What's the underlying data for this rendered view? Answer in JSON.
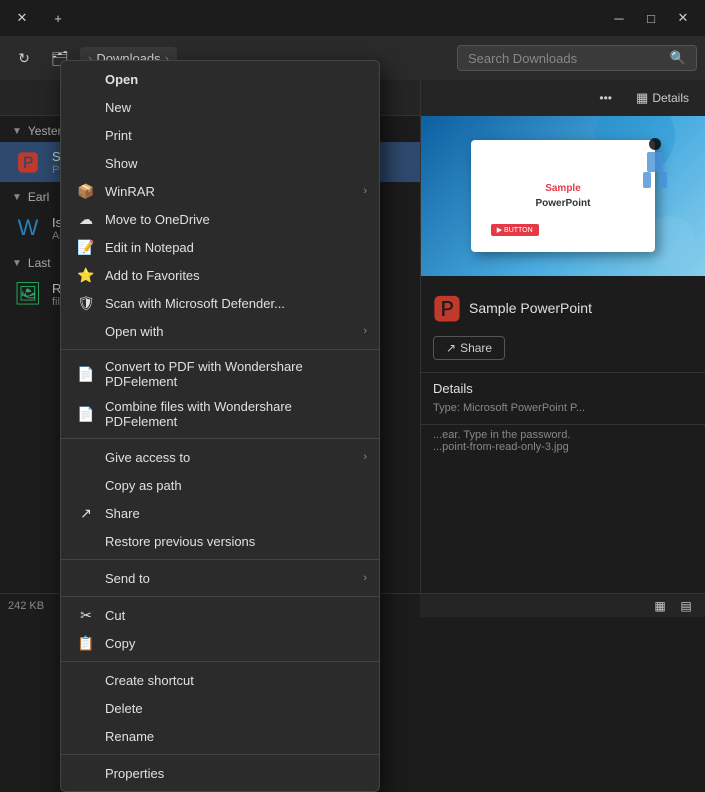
{
  "titlebar": {
    "close": "✕",
    "new_tab": "+",
    "minimize": "─",
    "maximize": "□"
  },
  "navbar": {
    "refresh_label": "↻",
    "breadcrumb": [
      "Downloads",
      "›"
    ],
    "search_placeholder": "Search Downloads",
    "search_icon": "🔍"
  },
  "toolbar": {
    "more_label": "•••",
    "details_label": "Details"
  },
  "sections": {
    "yesterday": "Yesterday",
    "earlier": "Earl",
    "last": "Last"
  },
  "files": [
    {
      "name": "Sa",
      "meta": "PowerPo..."
    },
    {
      "name": "Is Th...",
      "meta": "Ac... Acr..."
    },
    {
      "name": "R",
      "meta": "file-s..."
    }
  ],
  "status": "242 KB",
  "preview": {
    "title": "Sample PowerPoint",
    "accent": "▶ BUTTON"
  },
  "detail": {
    "filename": "Sample PowerPoint",
    "share_label": "Share",
    "details_heading": "Details",
    "type_label": "Type: Microsoft PowerPoint P...",
    "bottom_text": "...ear. Type in the password.",
    "bottom_file": "...point-from-read-only-3.jpg"
  },
  "context_menu": {
    "items": [
      {
        "label": "Open",
        "bold": true,
        "icon": "",
        "arrow": false
      },
      {
        "label": "New",
        "bold": false,
        "icon": "",
        "arrow": false
      },
      {
        "label": "Print",
        "bold": false,
        "icon": "",
        "arrow": false
      },
      {
        "label": "Show",
        "bold": false,
        "icon": "",
        "arrow": false
      },
      {
        "label": "WinRAR",
        "bold": false,
        "icon": "📦",
        "arrow": true
      },
      {
        "label": "Move to OneDrive",
        "bold": false,
        "icon": "☁",
        "arrow": false
      },
      {
        "label": "Edit in Notepad",
        "bold": false,
        "icon": "📝",
        "arrow": false
      },
      {
        "label": "Add to Favorites",
        "bold": false,
        "icon": "⭐",
        "arrow": false
      },
      {
        "label": "Scan with Microsoft Defender...",
        "bold": false,
        "icon": "🛡",
        "arrow": false
      },
      {
        "label": "Open with",
        "bold": false,
        "icon": "",
        "arrow": true
      },
      {
        "separator": true
      },
      {
        "label": "Convert to PDF with Wondershare PDFelement",
        "bold": false,
        "icon": "📄",
        "arrow": false
      },
      {
        "label": "Combine files with Wondershare PDFelement",
        "bold": false,
        "icon": "📄",
        "arrow": false
      },
      {
        "separator": true
      },
      {
        "label": "Give access to",
        "bold": false,
        "icon": "",
        "arrow": true
      },
      {
        "label": "Copy as path",
        "bold": false,
        "icon": "",
        "arrow": false
      },
      {
        "label": "Share",
        "bold": false,
        "icon": "↗",
        "arrow": false
      },
      {
        "label": "Restore previous versions",
        "bold": false,
        "icon": "",
        "arrow": false
      },
      {
        "separator": true
      },
      {
        "label": "Send to",
        "bold": false,
        "icon": "",
        "arrow": true
      },
      {
        "separator": true
      },
      {
        "label": "Cut",
        "bold": false,
        "icon": "✂",
        "arrow": false
      },
      {
        "label": "Copy",
        "bold": false,
        "icon": "📋",
        "arrow": false
      },
      {
        "separator": true
      },
      {
        "label": "Create shortcut",
        "bold": false,
        "icon": "",
        "arrow": false
      },
      {
        "label": "Delete",
        "bold": false,
        "icon": "",
        "arrow": false
      },
      {
        "label": "Rename",
        "bold": false,
        "icon": "",
        "arrow": false
      },
      {
        "separator": true
      },
      {
        "label": "Properties",
        "bold": false,
        "icon": "",
        "arrow": false
      }
    ]
  }
}
